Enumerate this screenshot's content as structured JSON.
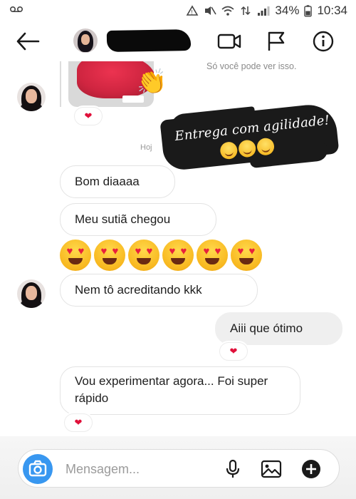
{
  "status_bar": {
    "battery": "34%",
    "time": "10:34"
  },
  "header": {
    "icons": [
      "back-arrow-icon",
      "video-call-icon",
      "flag-icon",
      "info-icon"
    ]
  },
  "chat": {
    "side_note": "Só você pode ver isso.",
    "timestamp": "Hoj",
    "sticker": {
      "text": "Entrega com agilidade!"
    },
    "messages": [
      {
        "text": "Bom diaaaa",
        "side": "left"
      },
      {
        "text": "Meu sutiã chegou",
        "side": "left"
      },
      {
        "text": "Nem tô acreditando kkk",
        "side": "left"
      },
      {
        "text": "Aiii que ótimo",
        "side": "right"
      },
      {
        "text": "Vou experimentar agora... Foi super rápido",
        "side": "left"
      }
    ],
    "reaction": "❤",
    "emoji_count": 6
  },
  "composer": {
    "placeholder": "Mensagem..."
  },
  "colors": {
    "accent": "#3897f0",
    "heart": "#e0103a",
    "bubble_right": "#efefef"
  }
}
